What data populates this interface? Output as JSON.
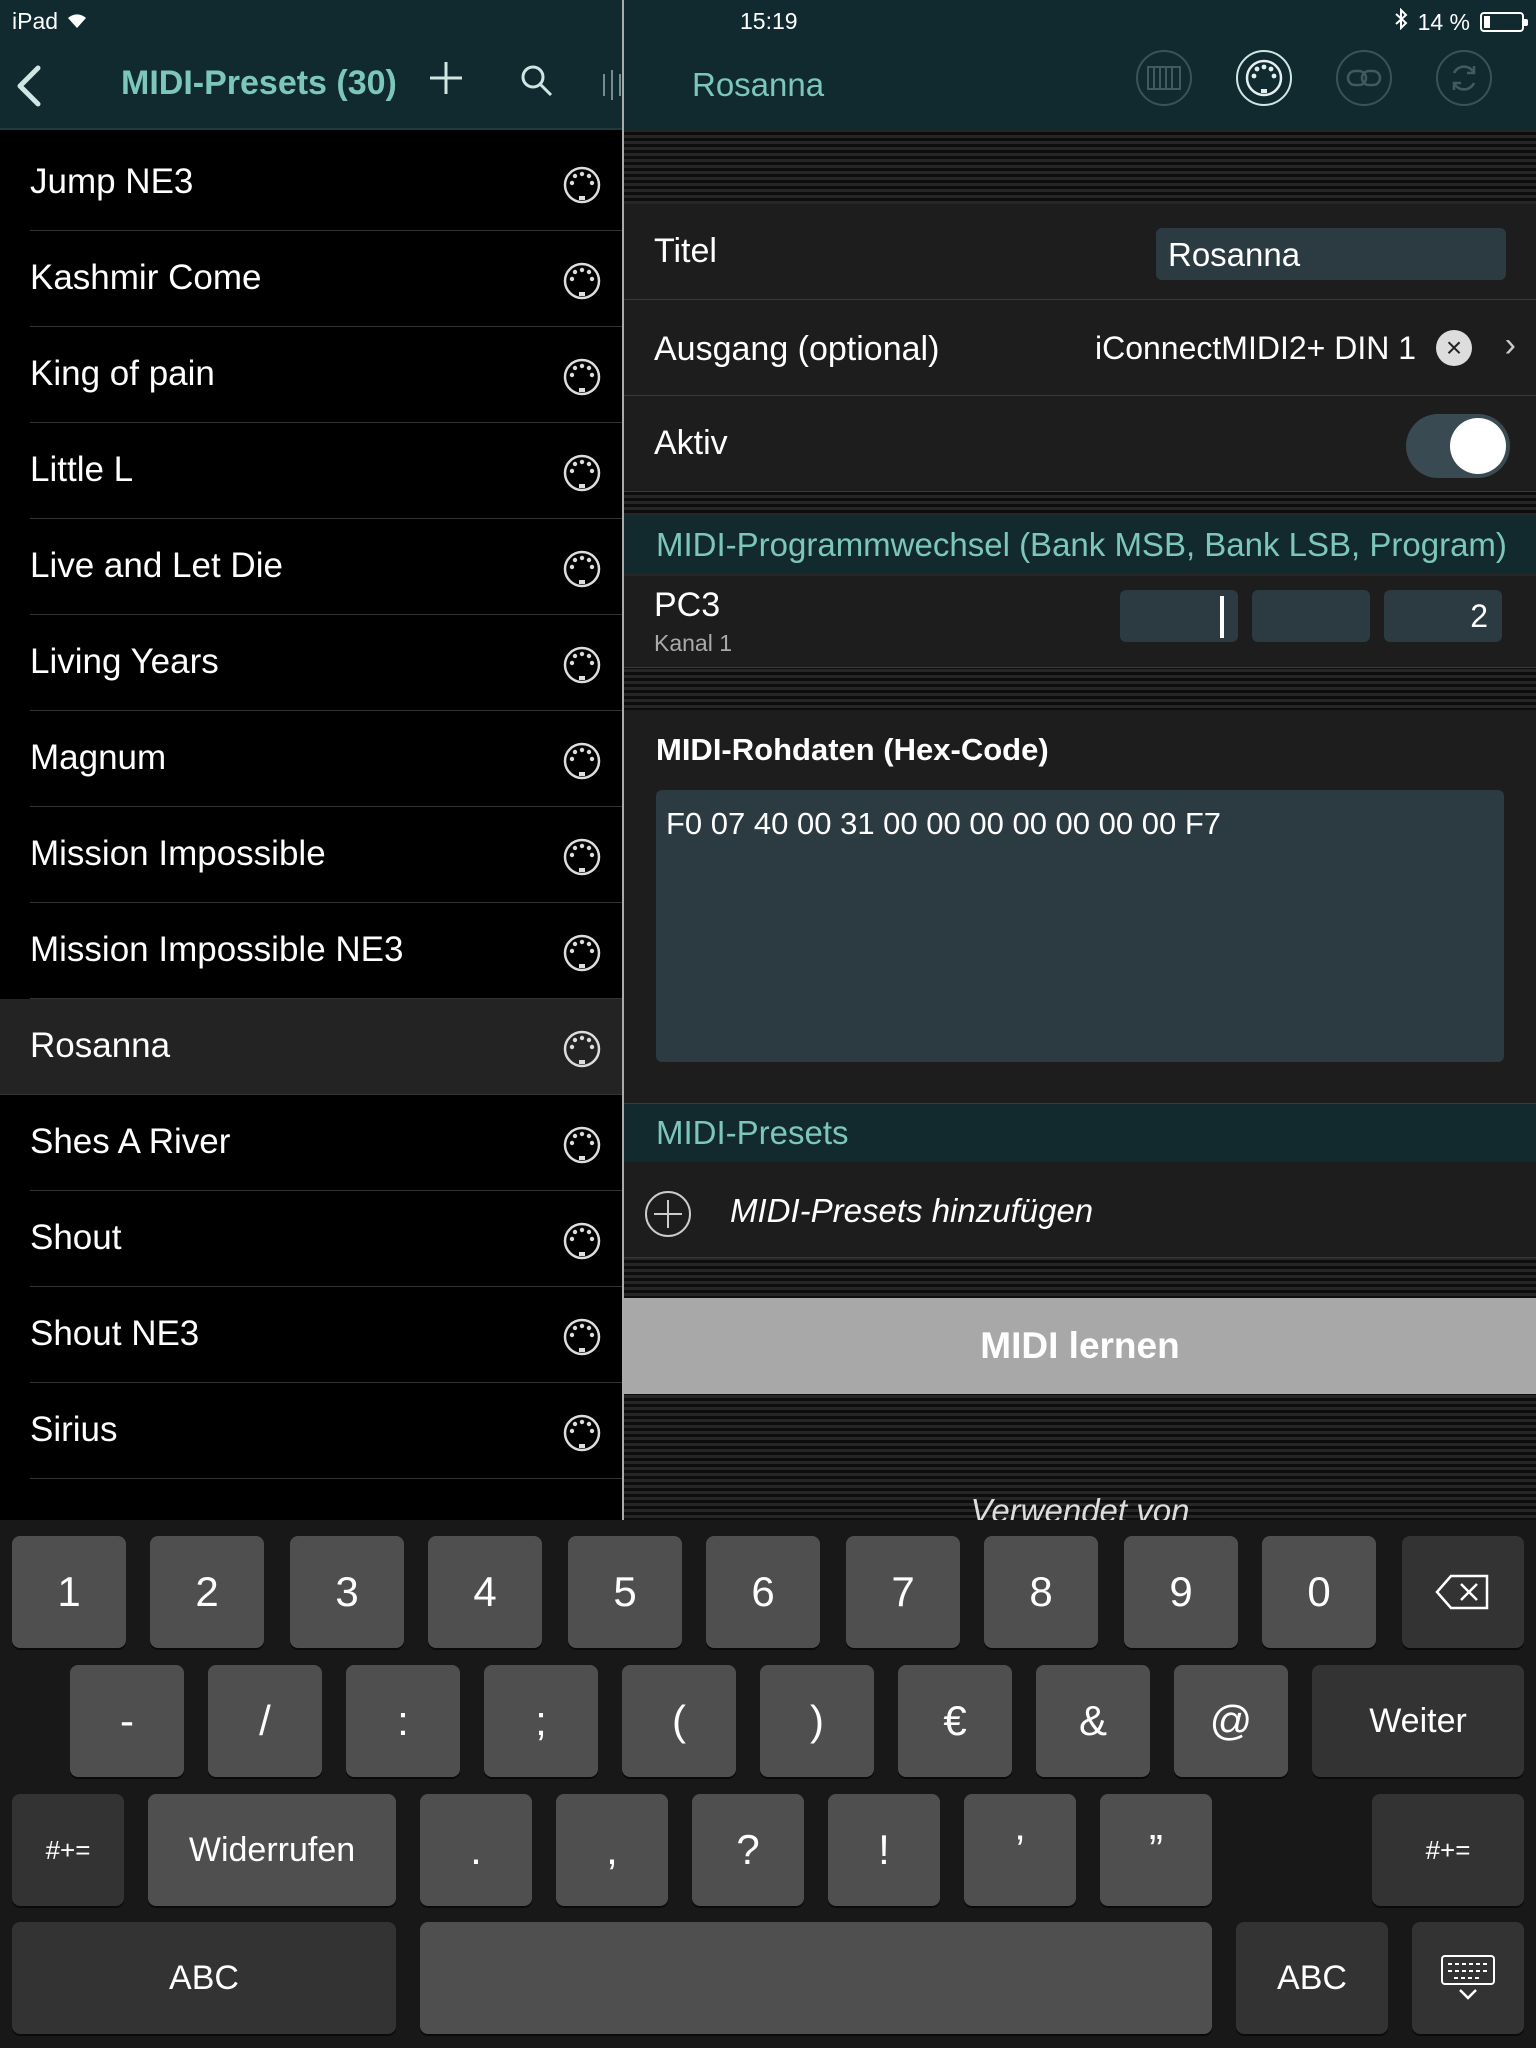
{
  "status": {
    "device": "iPad",
    "time": "15:19",
    "battery": "14 %"
  },
  "left": {
    "title": "MIDI-Presets (30)",
    "items": [
      "Jump NE3",
      "Kashmir Come",
      "King of pain",
      "Little L",
      "Live and Let Die",
      "Living Years",
      "Magnum",
      "Mission Impossible",
      "Mission Impossible NE3",
      "Rosanna",
      "Shes A River",
      "Shout",
      "Shout NE3",
      "Sirius"
    ],
    "selected": "Rosanna"
  },
  "right": {
    "title": "Rosanna",
    "titel_label": "Titel",
    "titel_value": "Rosanna",
    "output_label": "Ausgang (optional)",
    "output_value": "iConnectMIDI2+ DIN 1",
    "active_label": "Aktiv",
    "pc_section": "MIDI-Programmwechsel (Bank MSB, Bank LSB, Program)",
    "pc_label": "PC3",
    "pc_sub": "Kanal 1",
    "pc_msb": "",
    "pc_lsb": "",
    "pc_program": "2",
    "raw_label": "MIDI-Rohdaten (Hex-Code)",
    "raw_value": "F0 07 40 00 31 00 00 00 00 00 00 00 F7",
    "presets_section": "MIDI-Presets",
    "add_presets": "MIDI-Presets hinzufügen",
    "learn": "MIDI lernen",
    "used_by": "Verwendet von"
  },
  "keyboard": {
    "row1": [
      "1",
      "2",
      "3",
      "4",
      "5",
      "6",
      "7",
      "8",
      "9",
      "0"
    ],
    "row2": [
      "-",
      "/",
      ":",
      ";",
      "(",
      ")",
      "€",
      "&",
      "@"
    ],
    "next": "Weiter",
    "shift": "#+=",
    "undo": "Widerrufen",
    "row3": [
      ".",
      ",",
      "?",
      "!",
      "’",
      "”"
    ],
    "abc": "ABC"
  },
  "colors": {
    "accent": "#7cc6bc",
    "header_bg": "#102a30"
  }
}
